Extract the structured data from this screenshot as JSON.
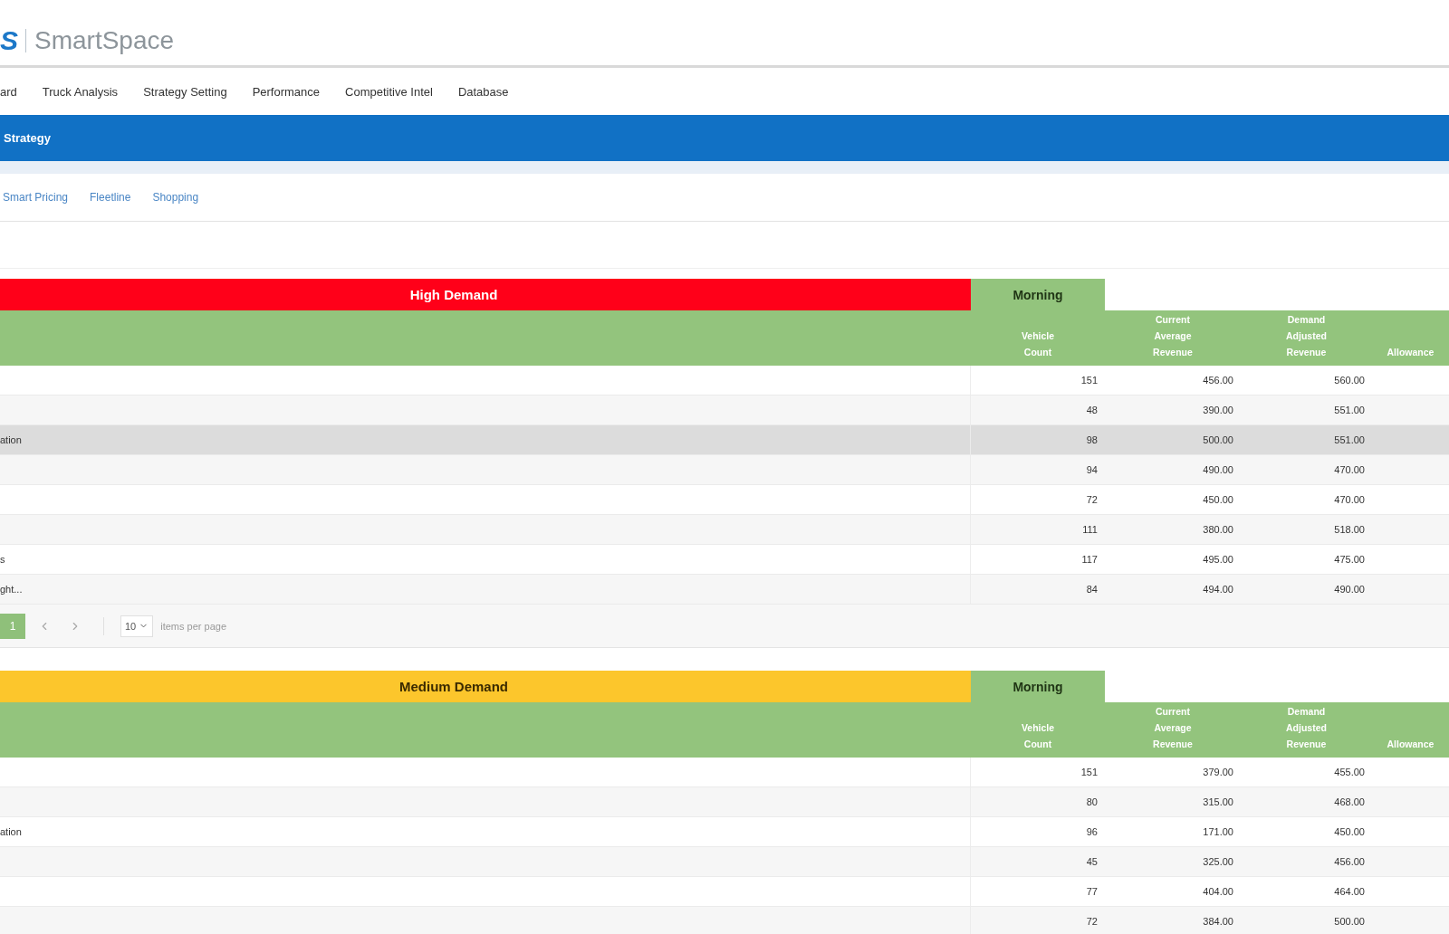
{
  "header": {
    "logo_mark": "S",
    "logo_text": "SmartSpace"
  },
  "nav": [
    "ard",
    "Truck Analysis",
    "Strategy Setting",
    "Performance",
    "Competitive Intel",
    "Database"
  ],
  "banner": {
    "title": "Strategy"
  },
  "subnav": [
    "Smart Pricing",
    "Fleetline",
    "Shopping"
  ],
  "tables": [
    {
      "title": "High Demand",
      "color": "#ff0019",
      "period": "Morning",
      "columns": [
        "Vehicle Count",
        "Current Average Revenue",
        "Demand Adjusted Revenue",
        "Allowance"
      ],
      "rows": [
        {
          "cells": [
            "151",
            "456.00",
            "560.00"
          ],
          "highlighted": false
        },
        {
          "cells": [
            "48",
            "390.00",
            "551.00"
          ],
          "highlighted": false
        },
        {
          "column_1": "ation",
          "cells": [
            "98",
            "500.00",
            "551.00"
          ],
          "highlighted": true
        },
        {
          "cells": [
            "94",
            "490.00",
            "470.00"
          ],
          "highlighted": false
        },
        {
          "cells": [
            "72",
            "450.00",
            "470.00"
          ],
          "highlighted": false
        },
        {
          "cells": [
            "111",
            "380.00",
            "518.00"
          ],
          "highlighted": false
        },
        {
          "column_1": "s",
          "cells": [
            "117",
            "495.00",
            "475.00"
          ],
          "highlighted": false
        },
        {
          "column_1": "ght...",
          "cells": [
            "84",
            "494.00",
            "490.00"
          ],
          "highlighted": false
        }
      ],
      "pager": {
        "pages": [
          {
            "label": "1",
            "selected": true
          }
        ],
        "page_size": "10",
        "page_size_label": "items per page"
      }
    },
    {
      "title": "Medium Demand",
      "color": "#fcc62c",
      "period": "Morning",
      "columns": [
        "Vehicle Count",
        "Current Average Revenue",
        "Demand Adjusted Revenue",
        "Allowance"
      ],
      "rows": [
        {
          "cells": [
            "151",
            "379.00",
            "455.00"
          ],
          "highlighted": false
        },
        {
          "cells": [
            "80",
            "315.00",
            "468.00"
          ],
          "highlighted": false
        },
        {
          "column_1": "ation",
          "cells": [
            "96",
            "171.00",
            "450.00"
          ],
          "highlighted": false
        },
        {
          "cells": [
            "45",
            "325.00",
            "456.00"
          ],
          "highlighted": false
        },
        {
          "cells": [
            "77",
            "404.00",
            "464.00"
          ],
          "highlighted": false
        },
        {
          "cells": [
            "72",
            "384.00",
            "500.00"
          ],
          "highlighted": false
        }
      ]
    }
  ]
}
